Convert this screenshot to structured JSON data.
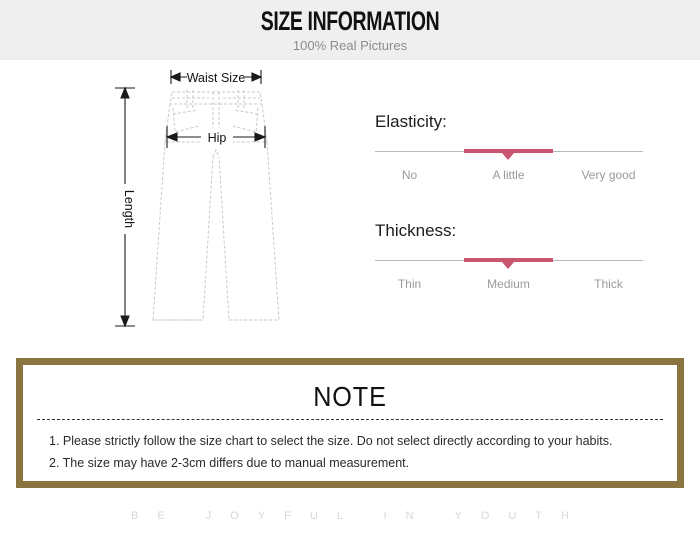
{
  "header": {
    "title": "SIZE INFORMATION",
    "subtitle": "100% Real Pictures"
  },
  "diagram": {
    "name": "pants-size-diagram",
    "labels": {
      "waist": "Waist Size",
      "hip": "Hip",
      "length": "Length"
    }
  },
  "meters": [
    {
      "name": "elasticity",
      "title": "Elasticity:",
      "options": [
        "No",
        "A little",
        "Very good"
      ],
      "selected": "A little",
      "selected_index": 1,
      "accent_color": "#c9556f"
    },
    {
      "name": "thickness",
      "title": "Thickness:",
      "options": [
        "Thin",
        "Medium",
        "Thick"
      ],
      "selected": "Medium",
      "selected_index": 1,
      "accent_color": "#c9556f"
    }
  ],
  "note": {
    "title": "NOTE",
    "border_color": "#8a7440",
    "items": [
      "1. Please strictly follow the size chart to select the size. Do not select directly according to your habits.",
      "2. The size may have 2-3cm differs due to manual measurement."
    ]
  },
  "footer": {
    "tagline": "BE JOYFUL IN YOUTH"
  }
}
